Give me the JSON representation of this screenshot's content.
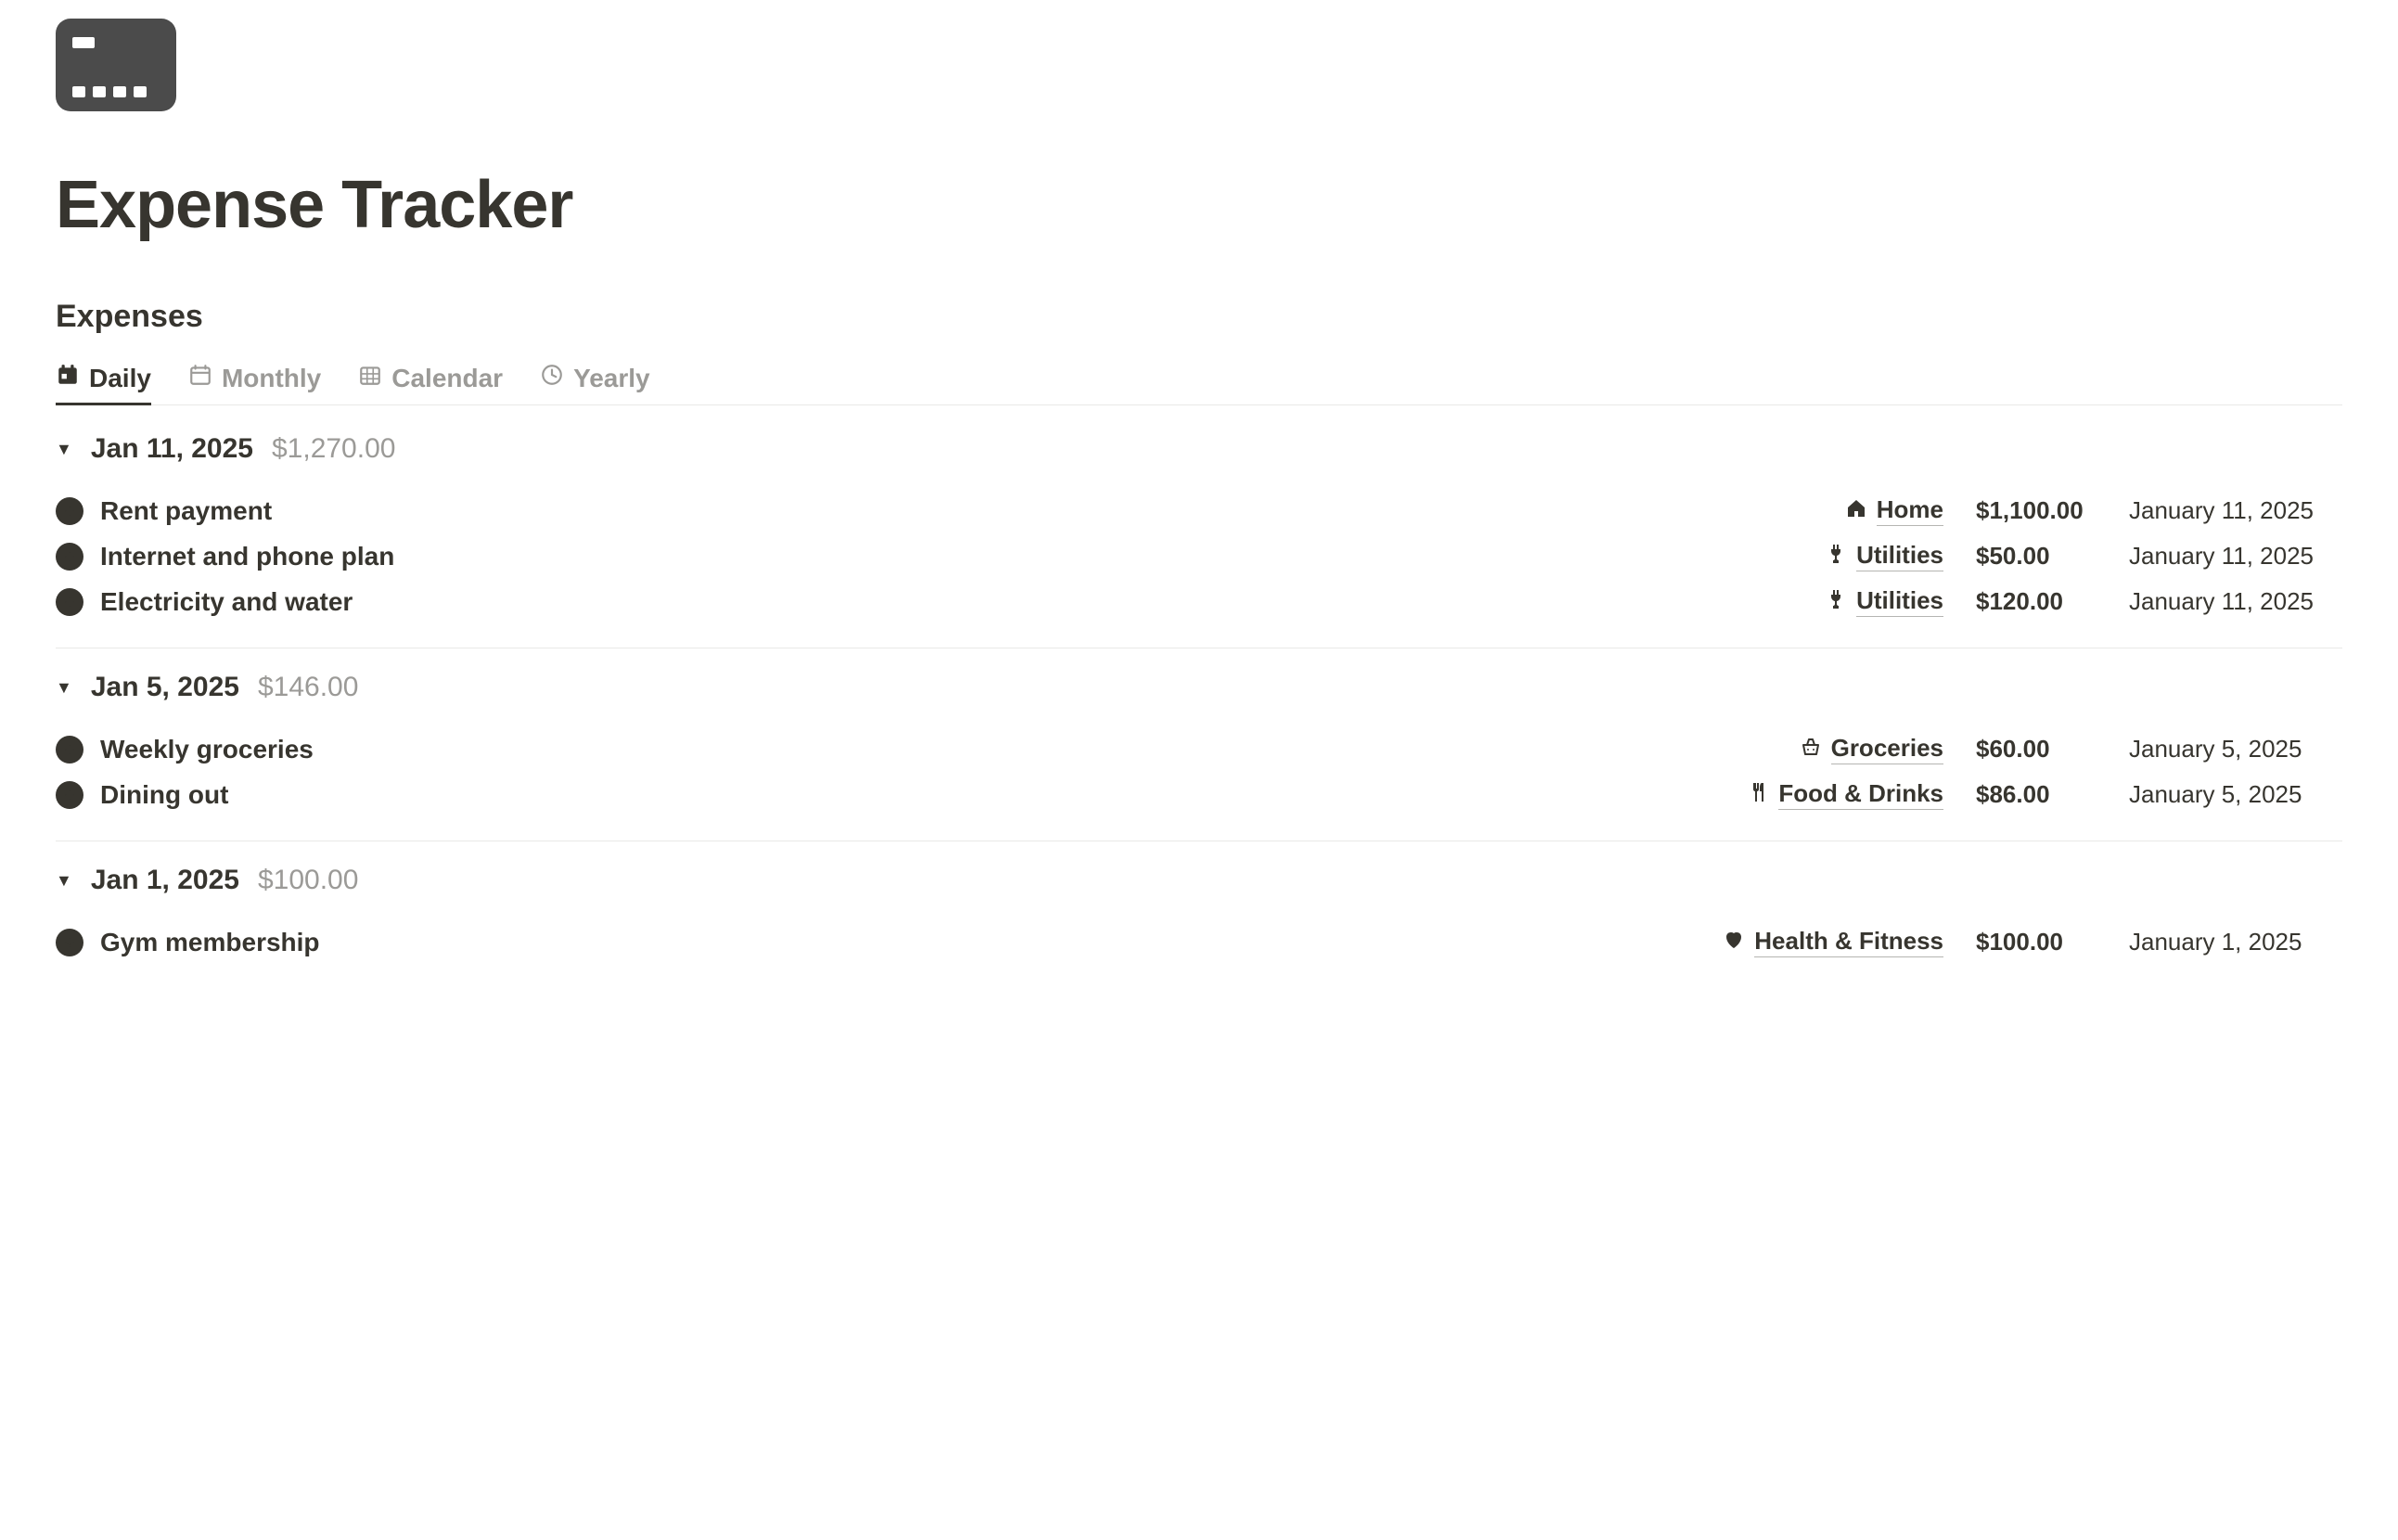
{
  "page": {
    "title": "Expense Tracker",
    "section_title": "Expenses"
  },
  "tabs": [
    {
      "label": "Daily",
      "icon": "calendar-day",
      "active": true
    },
    {
      "label": "Monthly",
      "icon": "calendar-month",
      "active": false
    },
    {
      "label": "Calendar",
      "icon": "calendar-grid",
      "active": false
    },
    {
      "label": "Yearly",
      "icon": "clock",
      "active": false
    }
  ],
  "groups": [
    {
      "date": "Jan 11, 2025",
      "total": "$1,270.00",
      "rows": [
        {
          "name": "Rent payment",
          "category_icon": "home",
          "category": "Home",
          "amount": "$1,100.00",
          "date": "January 11, 2025"
        },
        {
          "name": "Internet and phone plan",
          "category_icon": "plug",
          "category": "Utilities",
          "amount": "$50.00",
          "date": "January 11, 2025"
        },
        {
          "name": "Electricity and water",
          "category_icon": "plug",
          "category": "Utilities",
          "amount": "$120.00",
          "date": "January 11, 2025"
        }
      ]
    },
    {
      "date": "Jan 5, 2025",
      "total": "$146.00",
      "rows": [
        {
          "name": "Weekly groceries",
          "category_icon": "basket",
          "category": "Groceries",
          "amount": "$60.00",
          "date": "January 5, 2025"
        },
        {
          "name": "Dining out",
          "category_icon": "utensils",
          "category": "Food & Drinks",
          "amount": "$86.00",
          "date": "January 5, 2025"
        }
      ]
    },
    {
      "date": "Jan 1, 2025",
      "total": "$100.00",
      "rows": [
        {
          "name": "Gym membership",
          "category_icon": "heart",
          "category": "Health & Fitness",
          "amount": "$100.00",
          "date": "January 1, 2025"
        }
      ]
    }
  ]
}
